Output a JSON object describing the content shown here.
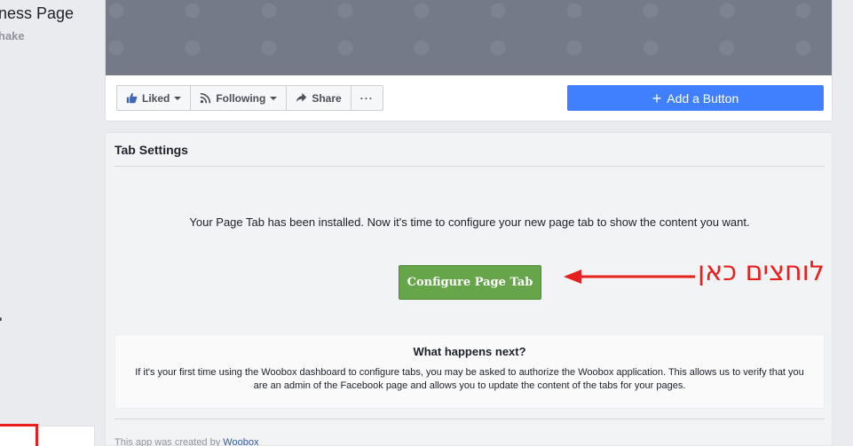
{
  "sidebar": {
    "page_name": "ness Page",
    "page_handle": "hake"
  },
  "action_bar": {
    "liked_label": "Liked",
    "following_label": "Following",
    "share_label": "Share",
    "more_label": "···",
    "add_button_label": "Add a Button"
  },
  "tab_settings": {
    "title": "Tab Settings",
    "installed_message": "Your Page Tab has been installed. Now it's time to configure your new page tab to show the content you want.",
    "configure_button_label": "Configure Page Tab",
    "what_next_title": "What happens next?",
    "what_next_body": "If it's your first time using the Woobox dashboard to configure tabs, you may be asked to authorize the Woobox application. This allows us to verify that you are an admin of the Facebook page and allows you to update the content of the tabs for your pages.",
    "footer_prefix": "This app was created by ",
    "footer_link": "Woobox"
  },
  "annotation": {
    "text": "לוחצים כאן",
    "color": "#e81f1f"
  },
  "colors": {
    "add_button": "#4080ff",
    "configure_button": "#67a54b",
    "cover": "#747a88"
  },
  "icons": {
    "liked": "thumbs-up-icon",
    "following": "rss-icon",
    "share": "share-arrow-icon",
    "add": "plus-icon"
  }
}
